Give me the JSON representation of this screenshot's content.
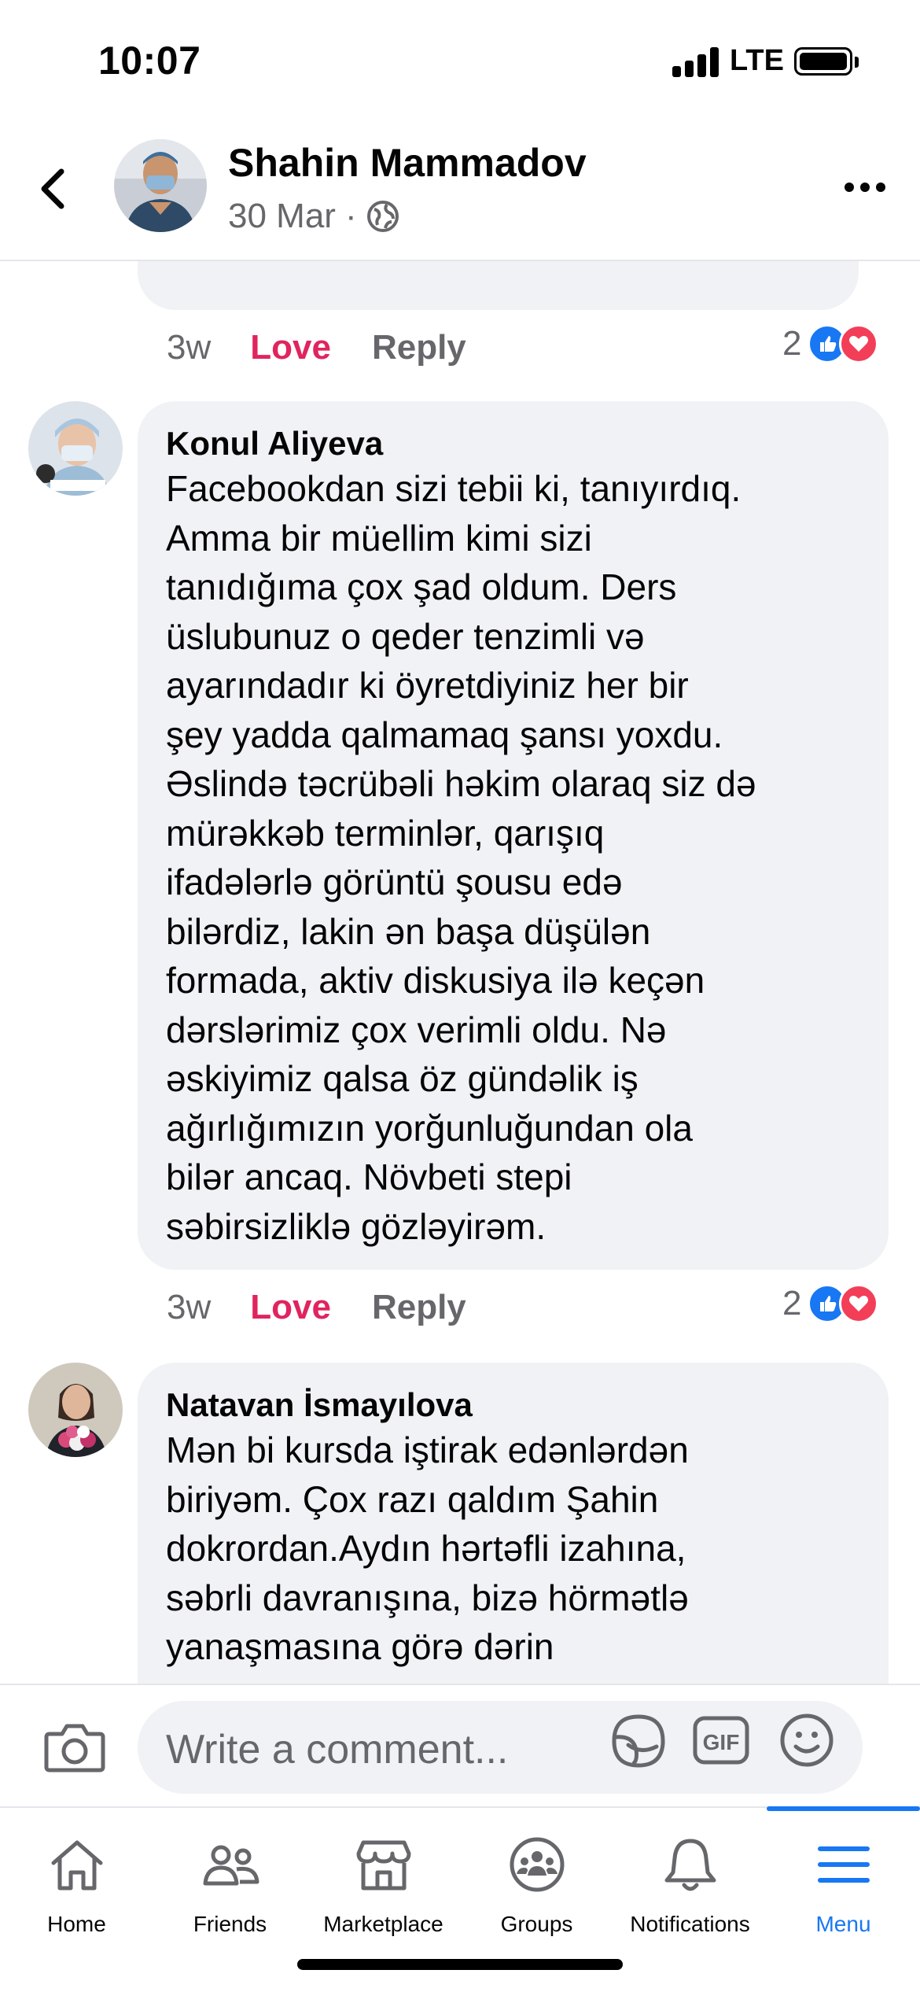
{
  "status_bar": {
    "time": "10:07",
    "network": "LTE"
  },
  "header": {
    "name": "Shahin Mammadov",
    "date": "30 Mar",
    "separator": "·",
    "privacy_icon": "globe-icon"
  },
  "comments": [
    {
      "author": "",
      "text": "",
      "age": "3w",
      "reaction_label": "Love",
      "reply_label": "Reply",
      "reaction_count": "2",
      "reaction_icons": [
        "like-icon",
        "heart-icon"
      ]
    },
    {
      "author": "Konul Aliyeva",
      "text": "Facebookdan sizi tebii ki, tanıyırdıq.\nAmma bir müellim kimi sizi\ntanıdığıma çox şad oldum. Ders\nüslubunuz o qeder tenzimli və\nayarındadır ki  öyretdiyiniz her bir\nşey yadda qalmamaq şansı yoxdu.\nƏslində təcrübəli həkim olaraq siz də\nmürəkkəb terminlər, qarışıq\nifadələrlə  görüntü şousu edə\nbilərdiz, lakin ən başa düşülən\nformada, aktiv diskusiya ilə keçən\ndərslərimiz çox verimli oldu. Nə\nəskiyimiz qalsa öz gündəlik iş\nağırlığımızın yorğunluğundan ola\nbilər ancaq. Növbeti stepi\nsəbirsizliklə gözləyirəm.",
      "age": "3w",
      "reaction_label": "Love",
      "reply_label": "Reply",
      "reaction_count": "2",
      "reaction_icons": [
        "like-icon",
        "heart-icon"
      ]
    },
    {
      "author": "Natavan İsmayılova",
      "text": "Mən bi kursda iştirak edənlərdən\nbiriyəm. Çox razı qaldım Şahin\ndokrordan.Aydın hərtəfli izahına,\nsəbrli davranışına, bizə hörmətlə\nyanaşmasına görə dərin"
    }
  ],
  "composer": {
    "placeholder": "Write a comment...",
    "camera_icon": "camera-icon",
    "sticker_icon": "sticker-icon",
    "gif_label": "GIF",
    "emoji_icon": "emoji-icon"
  },
  "tabs": [
    {
      "label": "Home",
      "icon": "home-icon",
      "active": false
    },
    {
      "label": "Friends",
      "icon": "friends-icon",
      "active": false
    },
    {
      "label": "Marketplace",
      "icon": "marketplace-icon",
      "active": false
    },
    {
      "label": "Groups",
      "icon": "groups-icon",
      "active": false
    },
    {
      "label": "Notifications",
      "icon": "bell-icon",
      "active": false
    },
    {
      "label": "Menu",
      "icon": "menu-icon",
      "active": true
    }
  ],
  "colors": {
    "accent": "#1877f2",
    "love": "#e0245e",
    "heart": "#f33e58",
    "bubble": "#f0f2f5",
    "secondary_text": "#65676b"
  }
}
